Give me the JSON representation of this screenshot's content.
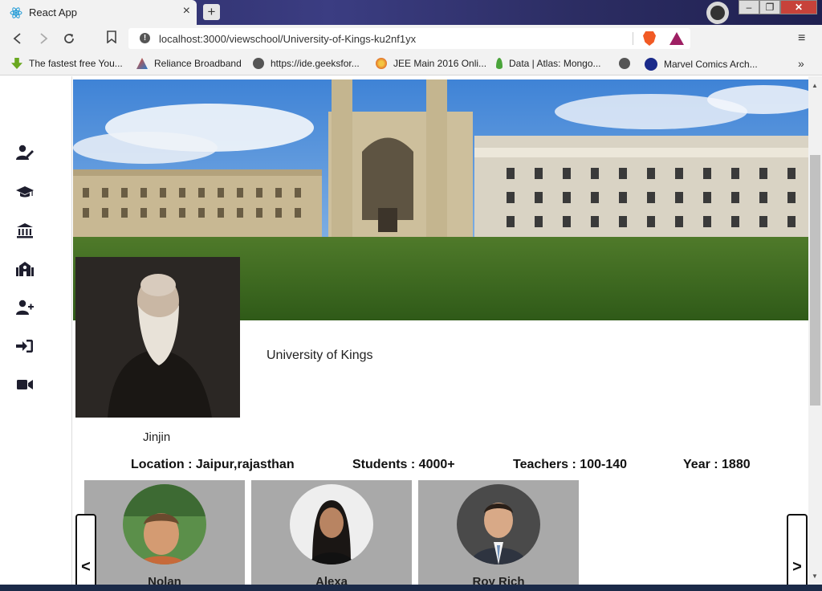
{
  "browser": {
    "tab_title": "React App",
    "tab_close": "×",
    "new_tab": "+",
    "url": "localhost:3000/viewschool/University-of-Kings-ku2nf1yx",
    "url_info_glyph": "!",
    "window_controls": {
      "minimize": "–",
      "maximize": "❐",
      "close": "✕"
    },
    "bookmarks": [
      {
        "label": "The fastest free You...",
        "icon": "download-arrow-icon",
        "color": "#6aa820"
      },
      {
        "label": "Reliance Broadband",
        "icon": "reliance-icon",
        "color": "#e84a2a"
      },
      {
        "label": "https://ide.geeksfor...",
        "icon": "globe-icon",
        "color": "#555555"
      },
      {
        "label": "JEE Main 2016 Onli...",
        "icon": "jee-icon",
        "color": "#e2722a"
      },
      {
        "label": "Data | Atlas: Mongo...",
        "icon": "leaf-icon",
        "color": "#4aa43a"
      },
      {
        "label": "",
        "icon": "globe-icon",
        "color": "#555555"
      },
      {
        "label": "Marvel Comics Arch...",
        "icon": "jio-icon",
        "color": "#1a2a8a"
      }
    ],
    "bookmarks_more": "»",
    "menu": "≡"
  },
  "sidebar": {
    "items": [
      {
        "name": "teacher-icon"
      },
      {
        "name": "graduation-cap-icon"
      },
      {
        "name": "university-icon"
      },
      {
        "name": "school-icon"
      },
      {
        "name": "add-user-icon"
      },
      {
        "name": "sign-in-icon"
      },
      {
        "name": "video-icon"
      }
    ]
  },
  "school": {
    "name": "University of Kings",
    "owner": "Jinjin",
    "location": "Location : Jaipur,rajasthan",
    "students": "Students : 4000+",
    "teachers": "Teachers : 100-140",
    "year": "Year : 1880"
  },
  "teachers": [
    {
      "name": "Nolan"
    },
    {
      "name": "Alexa"
    },
    {
      "name": "Roy Rich"
    }
  ],
  "carousel": {
    "prev": "<",
    "next": ">"
  }
}
